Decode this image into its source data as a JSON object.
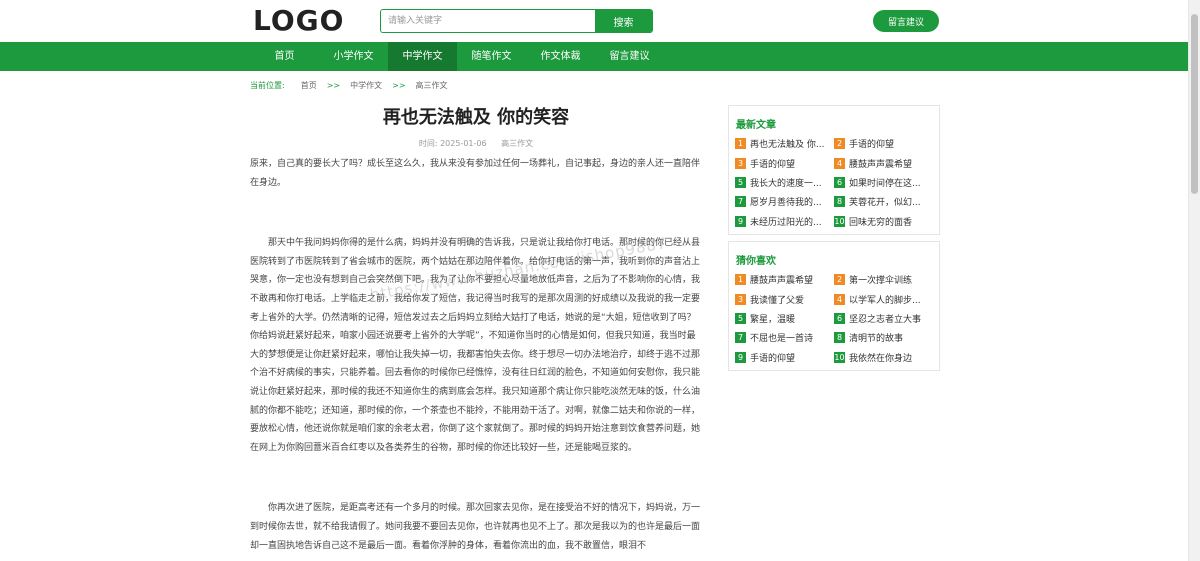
{
  "header": {
    "logo": "LOGO",
    "search_placeholder": "请输入关键字",
    "search_button": "搜索",
    "message_button": "留言建议"
  },
  "nav": [
    {
      "label": "首页"
    },
    {
      "label": "小学作文"
    },
    {
      "label": "中学作文",
      "active": true
    },
    {
      "label": "随笔作文"
    },
    {
      "label": "作文体裁"
    },
    {
      "label": "留言建议"
    }
  ],
  "breadcrumb": {
    "label": "当前位置:",
    "items": [
      "首页",
      "中学作文",
      "高三作文"
    ],
    "separator": ">>"
  },
  "article": {
    "title": "再也无法触及 你的笑容",
    "date": "时间: 2025-01-06",
    "category": "高三作文",
    "p1": "原来，自己真的要长大了吗？成长至这么久，我从来没有参加过任何一场葬礼，自记事起，身边的亲人还一直陪伴在身边。",
    "p2": "那天中午我问妈妈你得的是什么病，妈妈并没有明确的告诉我，只是说让我给你打电话。那时候的你已经从县医院转到了市医院转到了省会城市的医院，两个姑姑在那边陪伴着你。给你打电话的第一声，我听到你的声音沾上哭意，你一定也没有想到自己会突然倒下吧。我为了让你不要担心尽量地放低声音，之后为了不影响你的心情，我不敢再和你打电话。上学临走之前，我给你发了短信，我记得当时我写的是那次周测的好成绩以及我说的我一定要考上省外的大学。仍然清晰的记得，短信发过去之后妈妈立刻给大姑打了电话，她说的是“大姐，短信收到了吗？你给妈说赶紧好起来，咱家小园还说要考上省外的大学呢”，不知道你当时的心情是如何，但我只知道，我当时最大的梦想便是让你赶紧好起来，哪怕让我失掉一切，我都害怕失去你。终于想尽一切办法地治疗，却终于逃不过那个治不好病候的事实，只能养着。回去看你的时候你已经憔悴，没有往日红润的脸色，不知道如何安慰你，我只能说让你赶紧好起来，那时候的我还不知道你生的病到底会怎样。我只知道那个病让你只能吃淡然无味的饭，什么油腻的你都不能吃；还知道，那时候的你，一个茶壶也不能拎，不能用劲干活了。对啊，就像二姑夫和你说的一样，要放松心情，他还说你就是咱们家的余老太君，你倒了这个家就倒了。那时候的妈妈开始注意到饮食营养问题，她在网上为你购回薏米百合红枣以及各类养生的谷物，那时候的你还比较好一些，还是能喝豆浆的。",
    "p3": "你再次进了医院，是距高考还有一个多月的时候。那次回家去见你，是在接受治不好的情况下，妈妈说，万一到时候你去世，就不给我请假了。她问我要不要回去见你，也许就再也见不上了。那次是我以为的也许是最后一面却一直固执地告诉自己这不是最后一面。看着你浮肿的身体，看着你流出的血，我不敢置信，眼泪不"
  },
  "watermark": "https://www.huzhan.com/ishop9887",
  "latest": {
    "title": "最新文章",
    "items": [
      {
        "n": "1",
        "text": "再也无法触及 你..."
      },
      {
        "n": "2",
        "text": "手语的仰望"
      },
      {
        "n": "3",
        "text": "手语的仰望"
      },
      {
        "n": "4",
        "text": "腰鼓声声震希望"
      },
      {
        "n": "5",
        "text": "我长大的速度一..."
      },
      {
        "n": "6",
        "text": "如果时间停在这..."
      },
      {
        "n": "7",
        "text": "愿岁月善待我的..."
      },
      {
        "n": "8",
        "text": "芙蓉花开，似幻..."
      },
      {
        "n": "9",
        "text": "未经历过阳光的..."
      },
      {
        "n": "10",
        "text": "回味无穷的面香"
      }
    ]
  },
  "guess": {
    "title": "猜你喜欢",
    "items": [
      {
        "n": "1",
        "text": "腰鼓声声震希望"
      },
      {
        "n": "2",
        "text": "第一次撑伞训练"
      },
      {
        "n": "3",
        "text": "我读懂了父爱"
      },
      {
        "n": "4",
        "text": "以学军人的脚步..."
      },
      {
        "n": "5",
        "text": "繁星，温暖"
      },
      {
        "n": "6",
        "text": "坚忍之志者立大事"
      },
      {
        "n": "7",
        "text": "不屈也是一首诗"
      },
      {
        "n": "8",
        "text": "清明节的故事"
      },
      {
        "n": "9",
        "text": "手语的仰望"
      },
      {
        "n": "10",
        "text": "我依然在你身边"
      }
    ]
  },
  "colors": {
    "brand": "#1d9a3d",
    "rank_top": "#f08a24",
    "rank_rest": "#1d9a3d"
  }
}
